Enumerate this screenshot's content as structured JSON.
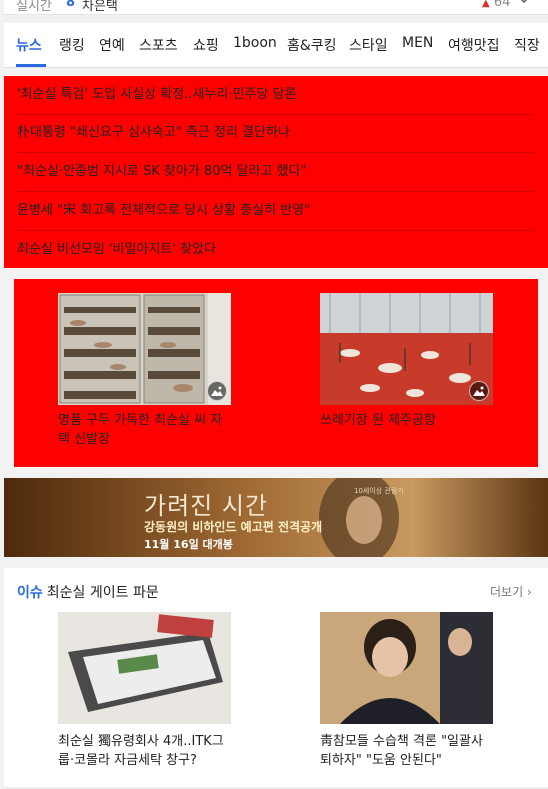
{
  "realtime": {
    "label": "실시간",
    "rank": "8",
    "word": "차은택",
    "count": "64"
  },
  "nav": {
    "tabs": [
      {
        "label": "뉴스",
        "active": true
      },
      {
        "label": "랭킹"
      },
      {
        "label": "연예"
      },
      {
        "label": "스포츠"
      },
      {
        "label": "쇼핑"
      },
      {
        "label": "1boon"
      },
      {
        "label": "홈&쿠킹"
      },
      {
        "label": "스타일"
      },
      {
        "label": "MEN"
      },
      {
        "label": "여행맛집"
      },
      {
        "label": "직장"
      }
    ]
  },
  "headlines": [
    "'최순실 특검' 도입 사실상 확정..새누리·민주당 당론",
    "朴대통령 \"쇄신요구 심사숙고\" 측근 정리 결단하나",
    "\"최순실·안종범 지시로 SK 찾아가 80억 달라고 했다\"",
    "윤병세 \"宋 회고록 전체적으로 당시 상황 충실히 반영\"",
    "최순실 비선모임 '비밀아지트' 찾았다"
  ],
  "photo_news": [
    {
      "caption": "명품 구두 가득한 최순실 씨 자택 신발장",
      "thumb_alt": "shoe-rack-photo"
    },
    {
      "caption": "쓰레기장 된 제주공항",
      "thumb_alt": "airport-trash-photo"
    }
  ],
  "banner": {
    "title": "가려진 시간",
    "subtitle": "강동원의 비하인드 예고편 전격공개",
    "release": "11월 16일 대개봉",
    "small": "10세이상 관람가"
  },
  "issue": {
    "tag": "이슈",
    "title": "최순실 게이트 파문",
    "more": "더보기",
    "items": [
      {
        "caption": "최순실 獨유령회사 4개..ITK그룹·코몰라 자금세탁 창구?"
      },
      {
        "caption": "靑참모들 수습책 격론 \"일괄사퇴하자\" \"도움 안된다\""
      }
    ]
  },
  "colors": {
    "accent": "#2a6be0",
    "highlight": "#ff0000",
    "up_arrow": "#e02b2b"
  }
}
